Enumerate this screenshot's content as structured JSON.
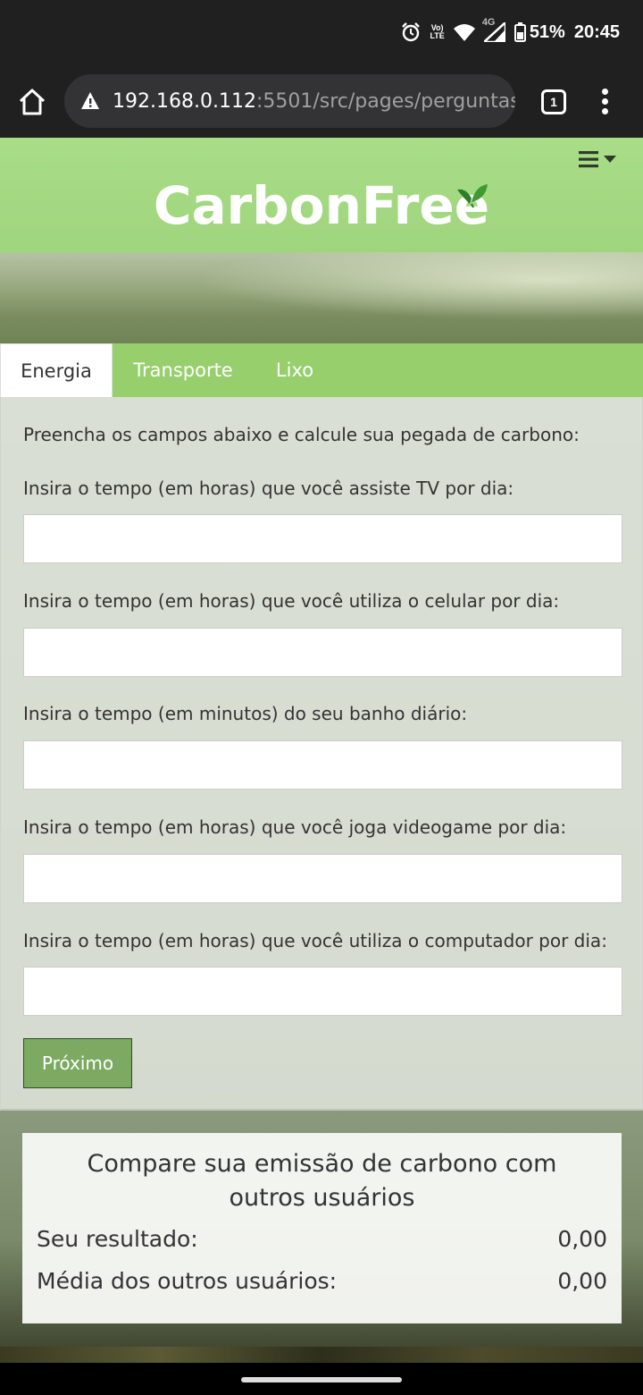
{
  "status_bar": {
    "icons": [
      "alarm-icon",
      "volte-icon",
      "wifi-icon",
      "signal-4g-icon",
      "battery-icon"
    ],
    "volte_top": "Vo)",
    "volte_bottom": "LTE",
    "network": "4G",
    "battery": "51%",
    "time": "20:45"
  },
  "browser": {
    "url_host": "192.168.0.112",
    "url_rest": ":5501/src/pages/perguntas",
    "tab_count": "1"
  },
  "header": {
    "logo": "CarbonFree"
  },
  "tabs": [
    {
      "label": "Energia",
      "active": true
    },
    {
      "label": "Transporte",
      "active": false
    },
    {
      "label": "Lixo",
      "active": false
    }
  ],
  "form": {
    "intro": "Preencha os campos abaixo e calcule sua pegada de carbono:",
    "fields": [
      {
        "label": "Insira o tempo (em horas) que você assiste TV por dia:",
        "value": ""
      },
      {
        "label": "Insira o tempo (em horas) que você utiliza o celular por dia:",
        "value": ""
      },
      {
        "label": "Insira o tempo (em minutos) do seu banho diário:",
        "value": ""
      },
      {
        "label": "Insira o tempo (em horas) que você joga videogame por dia:",
        "value": ""
      },
      {
        "label": "Insira o tempo (em horas) que você utiliza o computador por dia:",
        "value": ""
      }
    ],
    "next_label": "Próximo"
  },
  "compare": {
    "title": "Compare sua emissão de carbono com outros usuários",
    "your_result_label": "Seu resultado:",
    "your_result_value": "0,00",
    "average_label": "Média dos outros usuários:",
    "average_value": "0,00"
  },
  "colors": {
    "header_green": "#a9dd88",
    "tab_bar_green": "#96cf6c",
    "button_green": "#7daa62"
  }
}
